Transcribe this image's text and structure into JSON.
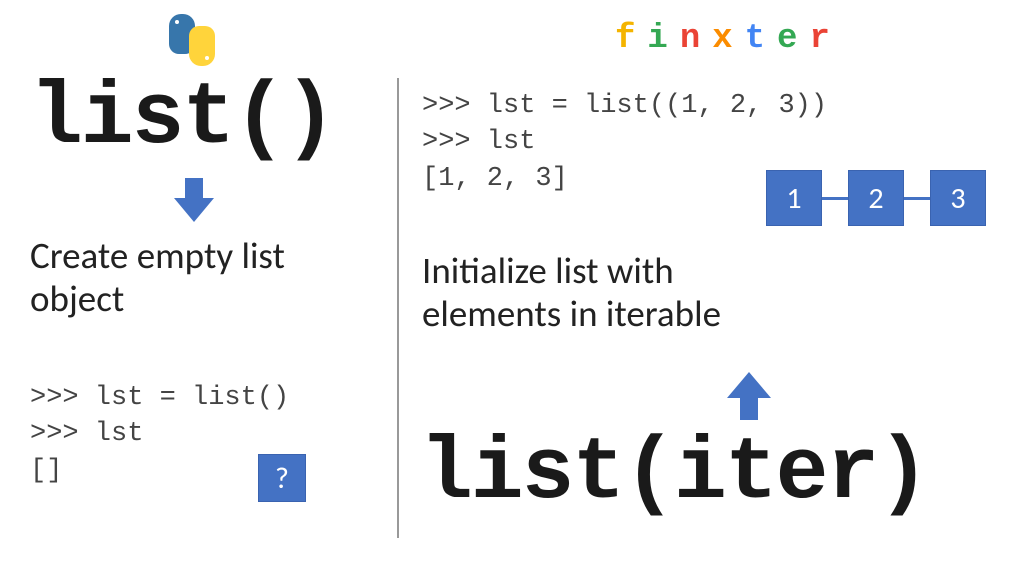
{
  "brand": {
    "letters": [
      "f",
      "i",
      "n",
      "x",
      "t",
      "e",
      "r"
    ],
    "colors": [
      "#f4b400",
      "#34a853",
      "#ea4335",
      "#fb8c00",
      "#4285f4",
      "#34a853",
      "#ea4335"
    ]
  },
  "left": {
    "heading": "list()",
    "desc_line1": "Create empty list",
    "desc_line2": "object",
    "code": ">>> lst = list()\n>>> lst\n[]",
    "question_mark": "?"
  },
  "right": {
    "heading": "list(iter)",
    "desc_line1": "Initialize list with",
    "desc_line2": "elements in iterable",
    "code": ">>> lst = list((1, 2, 3))\n>>> lst\n[1, 2, 3]",
    "nodes": [
      "1",
      "2",
      "3"
    ]
  },
  "icons": {
    "python": "python-logo",
    "arrow_down": "↓",
    "arrow_up": "↑"
  }
}
